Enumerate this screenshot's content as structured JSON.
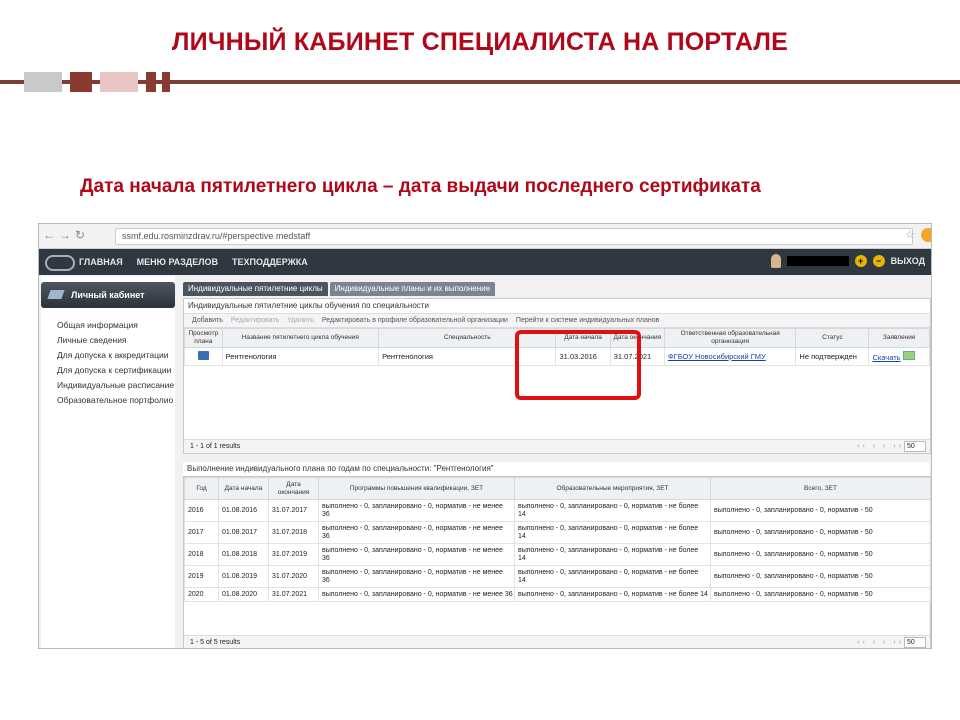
{
  "slide": {
    "title": "ЛИЧНЫЙ КАБИНЕТ СПЕЦИАЛИСТА НА ПОРТАЛЕ",
    "subtitle": "Дата начала пятилетнего цикла – дата выдачи последнего сертификата",
    "colors": {
      "title": "#b0081a",
      "bar": "#7a3e36",
      "highlight": "#e01010"
    }
  },
  "browser": {
    "nav_icons": [
      "back-icon",
      "forward-icon",
      "reload-icon"
    ],
    "url": "ssmf.edu.rosminzdrav.ru/#perspective medstaff",
    "star": "☆"
  },
  "appbar": {
    "menu": [
      "ГЛАВНАЯ",
      "МЕНЮ РАЗДЕЛОВ",
      "ТЕХПОДДЕРЖКА"
    ],
    "exit": "ВЫХОД"
  },
  "sidebar": {
    "header": "Личный кабинет",
    "items": [
      "Общая информация",
      "Личные сведения",
      "Для допуска к аккредитации",
      "Для допуска к сертификации",
      "Индивидуальные расписание",
      "Образовательное портфолио"
    ]
  },
  "tabs": [
    "Индивидуальные пятилетние циклы",
    "Индивидуальные планы и их выполнение"
  ],
  "cycles": {
    "title": "Индивидуальные пятилетние циклы обучения по специальности",
    "toolbar": [
      "Добавить",
      "Редактировать",
      "Удалить",
      "Редактировать в профиле образовательной организации",
      "Перейти к системе индивидуальных планов"
    ],
    "columns": [
      "Просмотр плана",
      "Название пятилетнего цикла обучения",
      "Специальность",
      "Дата начала",
      "Дата окончания",
      "Ответственная образовательная организация",
      "Статус",
      "Заявление"
    ],
    "rows": [
      {
        "name": "Рентгенология",
        "specialty": "Рентгенология",
        "start": "31.03.2016",
        "end": "31.07.2021",
        "org": "ФГБОУ Новосибирский ГМУ",
        "status": "Не подтвержден",
        "app": "Скачать"
      }
    ],
    "pager": "1 - 1 of 1 results",
    "page_size": "50"
  },
  "plan": {
    "title": "Выполнение индивидуального плана по годам по специальности: \"Рентгенология\"",
    "columns": [
      "Год",
      "Дата начала",
      "Дата окончания",
      "Программы повышения квалификации, ЗЕТ",
      "Образовательные мероприятия, ЗЕТ",
      "Всего, ЗЕТ"
    ],
    "rows": [
      {
        "year": "2016",
        "start": "01.08.2016",
        "end": "31.07.2017",
        "prog": "выполнено - 0, запланировано - 0, норматив - не менее 36",
        "events": "выполнено - 0, запланировано - 0, норматив - не более 14",
        "total": "выполнено - 0, запланировано - 0, норматив - 50"
      },
      {
        "year": "2017",
        "start": "01.08.2017",
        "end": "31.07.2018",
        "prog": "выполнено - 0, запланировано - 0, норматив - не менее 36",
        "events": "выполнено - 0, запланировано - 0, норматив - не более 14",
        "total": "выполнено - 0, запланировано - 0, норматив - 50"
      },
      {
        "year": "2018",
        "start": "01.08.2018",
        "end": "31.07.2019",
        "prog": "выполнено - 0, запланировано - 0, норматив - не менее 36",
        "events": "выполнено - 0, запланировано - 0, норматив - не более 14",
        "total": "выполнено - 0, запланировано - 0, норматив - 50"
      },
      {
        "year": "2019",
        "start": "01.08.2019",
        "end": "31.07.2020",
        "prog": "выполнено - 0, запланировано - 0, норматив - не менее 36",
        "events": "выполнено - 0, запланировано - 0, норматив - не более 14",
        "total": "выполнено - 0, запланировано - 0, норматив - 50"
      },
      {
        "year": "2020",
        "start": "01.08.2020",
        "end": "31.07.2021",
        "prog": "выполнено - 0, запланировано - 0, норматив - не менее 36",
        "events": "выполнено - 0, запланировано - 0, норматив - не более 14",
        "total": "выполнено - 0, запланировано - 0, норматив - 50"
      }
    ],
    "pager": "1 - 5 of 5 results",
    "page_size": "50"
  }
}
